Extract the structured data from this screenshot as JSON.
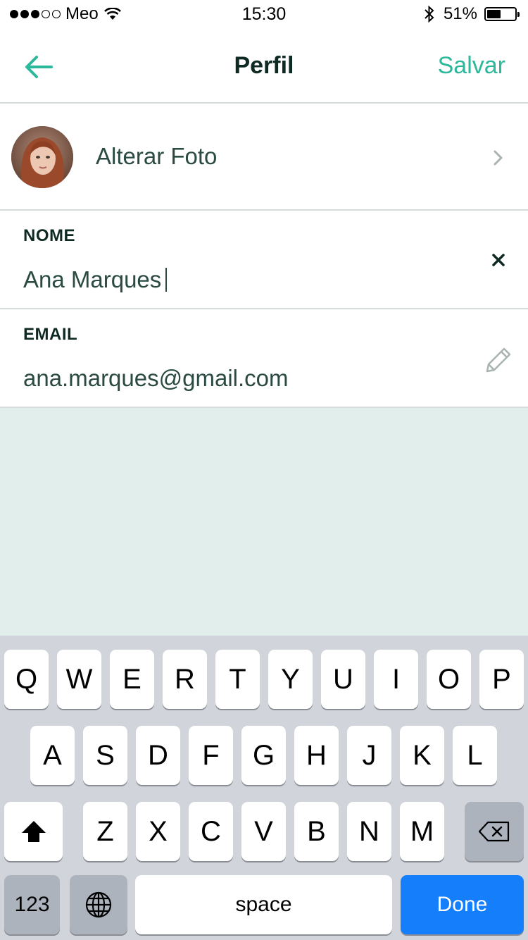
{
  "status_bar": {
    "carrier": "Meo",
    "time": "15:30",
    "battery_percent": "51%",
    "battery_level": 0.51
  },
  "nav": {
    "title": "Perfil",
    "save_label": "Salvar",
    "accent_color": "#2cb89a"
  },
  "photo_row": {
    "label": "Alterar Foto"
  },
  "fields": {
    "name": {
      "label": "NOME",
      "value": "Ana Marques"
    },
    "email": {
      "label": "EMAIL",
      "value": "ana.marques@gmail.com"
    }
  },
  "keyboard": {
    "row1": [
      "Q",
      "W",
      "E",
      "R",
      "T",
      "Y",
      "U",
      "I",
      "O",
      "P"
    ],
    "row2": [
      "A",
      "S",
      "D",
      "F",
      "G",
      "H",
      "J",
      "K",
      "L"
    ],
    "row3": [
      "Z",
      "X",
      "C",
      "V",
      "B",
      "N",
      "M"
    ],
    "numbers_label": "123",
    "space_label": "space",
    "done_label": "Done",
    "done_color": "#147efb"
  }
}
